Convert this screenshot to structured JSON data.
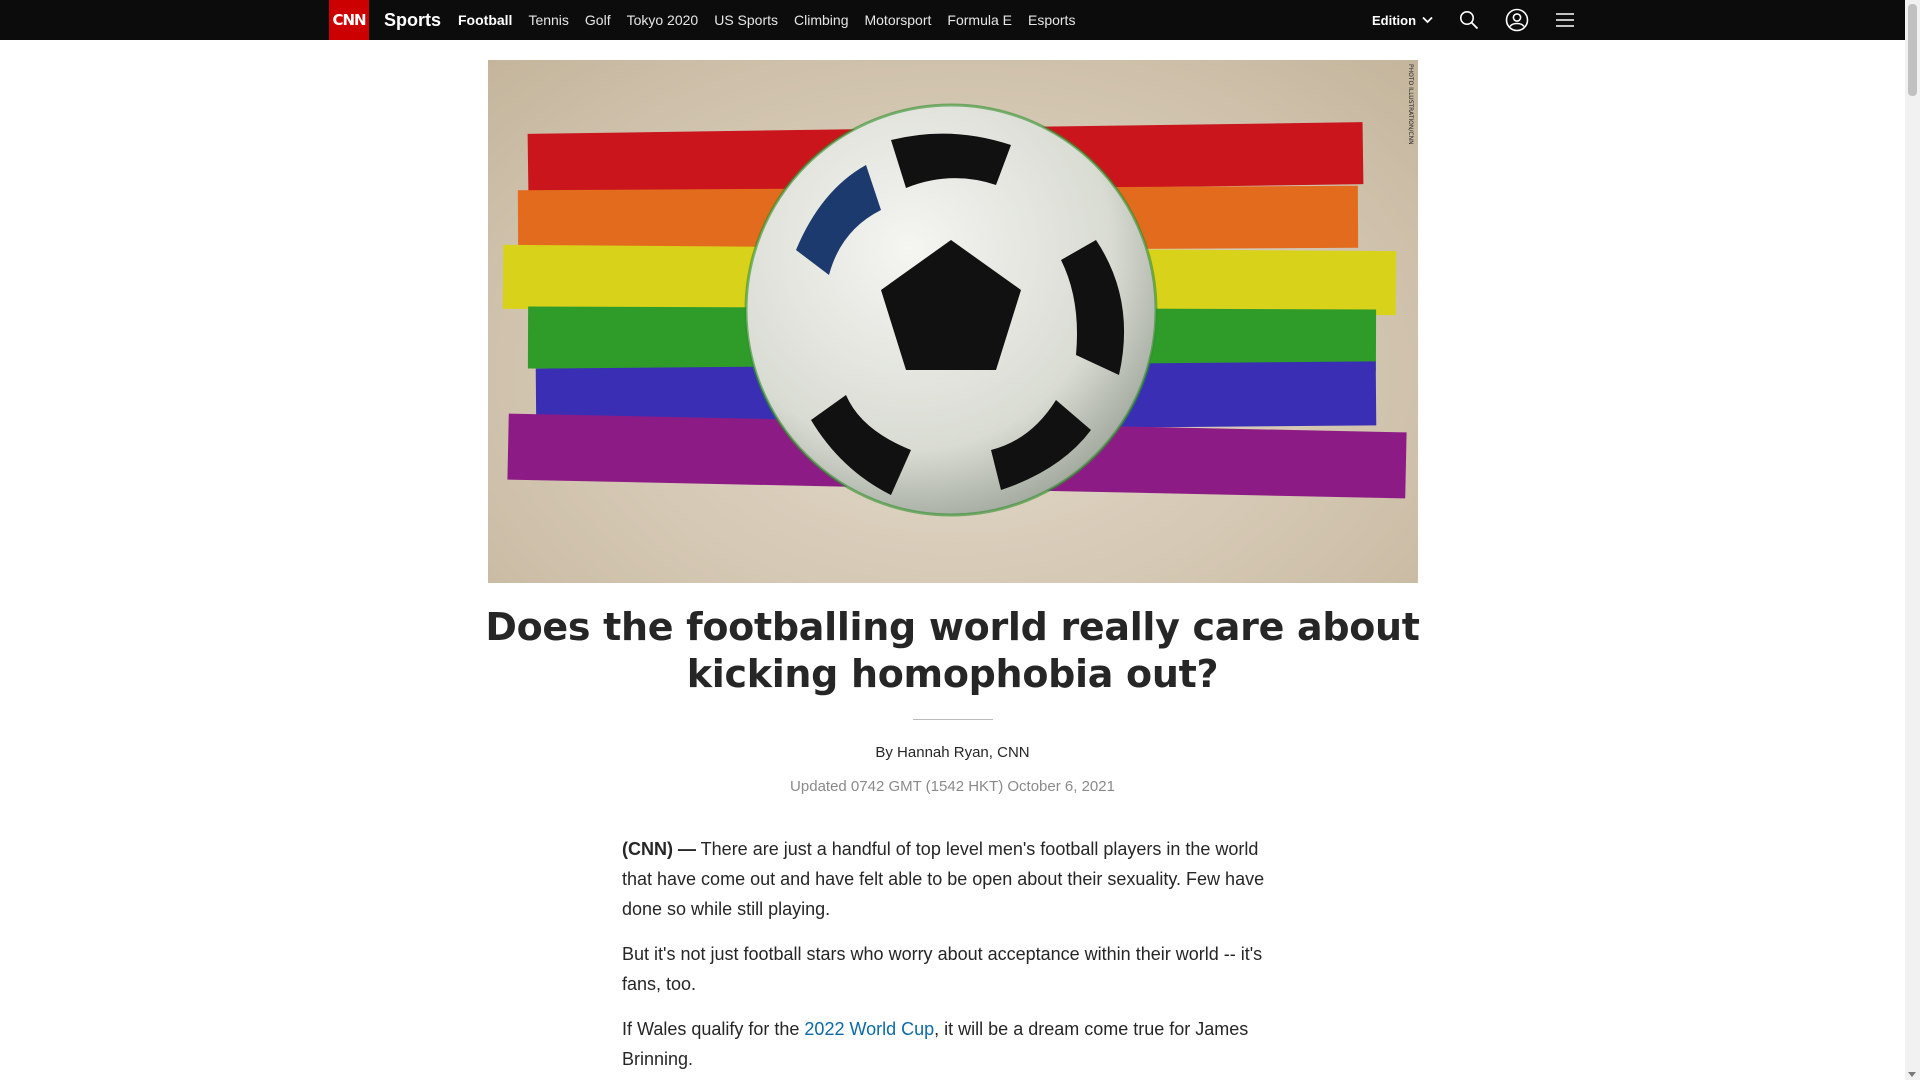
{
  "nav": {
    "logo": "CNN",
    "brand": "Sports",
    "links": [
      "Football",
      "Tennis",
      "Golf",
      "Tokyo 2020",
      "US Sports",
      "Climbing",
      "Motorsport",
      "Formula E",
      "Esports"
    ],
    "active": "Football",
    "edition_label": "Edition"
  },
  "icons": {
    "search": "search-icon",
    "account": "user-account-icon",
    "menu": "hamburger-menu-icon",
    "edition": "chevron-down-icon"
  },
  "colors": {
    "nav_bg": "#0c0c0c",
    "brand_red": "#cc0000",
    "link_blue": "#0c6aa5",
    "rainbow": [
      "#c9151b",
      "#e26b1e",
      "#d9d21b",
      "#2f9c2a",
      "#3a2fb4",
      "#8d1b86"
    ]
  },
  "hero": {
    "credit": "PHOTO ILLUSTRATION/CNN"
  },
  "article": {
    "headline": "Does the footballing world really care about kicking homophobia out?",
    "byline": "By Hannah Ryan, CNN",
    "updated": "Updated 0742 GMT (1542 HKT) October 6, 2021",
    "paragraphs": [
      {
        "source": "(CNN) —",
        "text": " There are just a handful of top level men's football players in the world that have come out and have felt able to be open about their sexuality. Few have done so while still playing."
      },
      {
        "text": "But it's not just football stars who worry about acceptance within their world -- it's fans, too."
      },
      {
        "before": "If Wales qualify for the ",
        "link": "2022 World Cup",
        "after": ", it will be a dream come true for James Brinning."
      }
    ]
  }
}
